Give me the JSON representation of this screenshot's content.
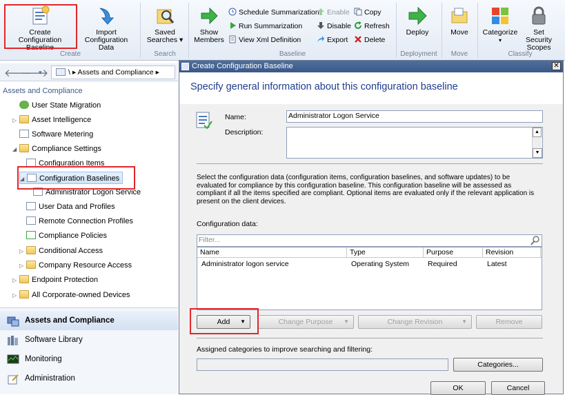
{
  "ribbon": {
    "create_baseline": "Create\nConfiguration Baseline",
    "create_baseline_l1": "Create",
    "create_baseline_l2": "Configuration Baseline",
    "import_l1": "Import",
    "import_l2": "Configuration Data",
    "group_create": "Create",
    "saved_l1": "Saved",
    "saved_l2": "Searches ▾",
    "group_search": "Search",
    "show_l1": "Show",
    "show_l2": "Members",
    "schedule_summarization": "Schedule Summarization",
    "run_summarization": "Run Summarization",
    "view_xml": "View Xml Definition",
    "enable": "Enable",
    "disable": "Disable",
    "export": "Export",
    "copy": "Copy",
    "refresh": "Refresh",
    "delete": "Delete",
    "group_baseline": "Baseline",
    "deploy": "Deploy",
    "group_deployment": "Deployment",
    "move": "Move",
    "group_move": "Move",
    "categorize": "Categorize",
    "categorize_arrow": "▾",
    "security_l1": "Set Security",
    "security_l2": "Scopes",
    "group_classify": "Classify"
  },
  "nav": {
    "back": "🡐",
    "forward": "🡒",
    "breadcrumb": "\\  ▸  Assets and Compliance  ▸"
  },
  "tree": {
    "section": "Assets and Compliance",
    "items": [
      {
        "label": "User State Migration"
      },
      {
        "label": "Asset Intelligence"
      },
      {
        "label": "Software Metering"
      },
      {
        "label": "Compliance Settings"
      },
      {
        "label": "Configuration Items"
      },
      {
        "label": "Configuration Baselines"
      },
      {
        "label": "Administrator Logon Service"
      },
      {
        "label": "User Data and Profiles"
      },
      {
        "label": "Remote Connection Profiles"
      },
      {
        "label": "Compliance Policies"
      },
      {
        "label": "Conditional Access"
      },
      {
        "label": "Company Resource Access"
      },
      {
        "label": "Endpoint Protection"
      },
      {
        "label": "All Corporate-owned Devices"
      }
    ]
  },
  "workspaces": [
    {
      "label": "Assets and Compliance"
    },
    {
      "label": "Software Library"
    },
    {
      "label": "Monitoring"
    },
    {
      "label": "Administration"
    }
  ],
  "dialog": {
    "title": "Create Configuration Baseline",
    "close": "✕",
    "heading": "Specify general information about this configuration baseline",
    "name_label": "Name:",
    "name_value": "Administrator Logon Service",
    "description_label": "Description:",
    "description_value": "",
    "info_text": "Select the configuration data (configuration items, configuration baselines, and software updates) to be evaluated for compliance by this configuration baseline. This configuration baseline will be assessed as compliant if all the items specified are compliant. Optional items are evaluated only if the relevant application is present on  the client devices.",
    "config_data_label": "Configuration data:",
    "filter_placeholder": "Filter...",
    "columns": [
      "Name",
      "Type",
      "Purpose",
      "Revision"
    ],
    "rows": [
      {
        "name": "Administrator logon service",
        "type": "Operating System",
        "purpose": "Required",
        "revision": "Latest"
      }
    ],
    "add_button": "Add",
    "change_purpose": "Change Purpose",
    "change_revision": "Change Revision",
    "remove": "Remove",
    "categories_label": "Assigned categories to improve searching and filtering:",
    "categories_value": "",
    "categories_button": "Categories...",
    "ok": "OK",
    "cancel": "Cancel"
  },
  "colors": {
    "highlight_box": "#e0262b",
    "dialog_heading": "#1f3e8c",
    "title_bar": "#3a5889"
  }
}
